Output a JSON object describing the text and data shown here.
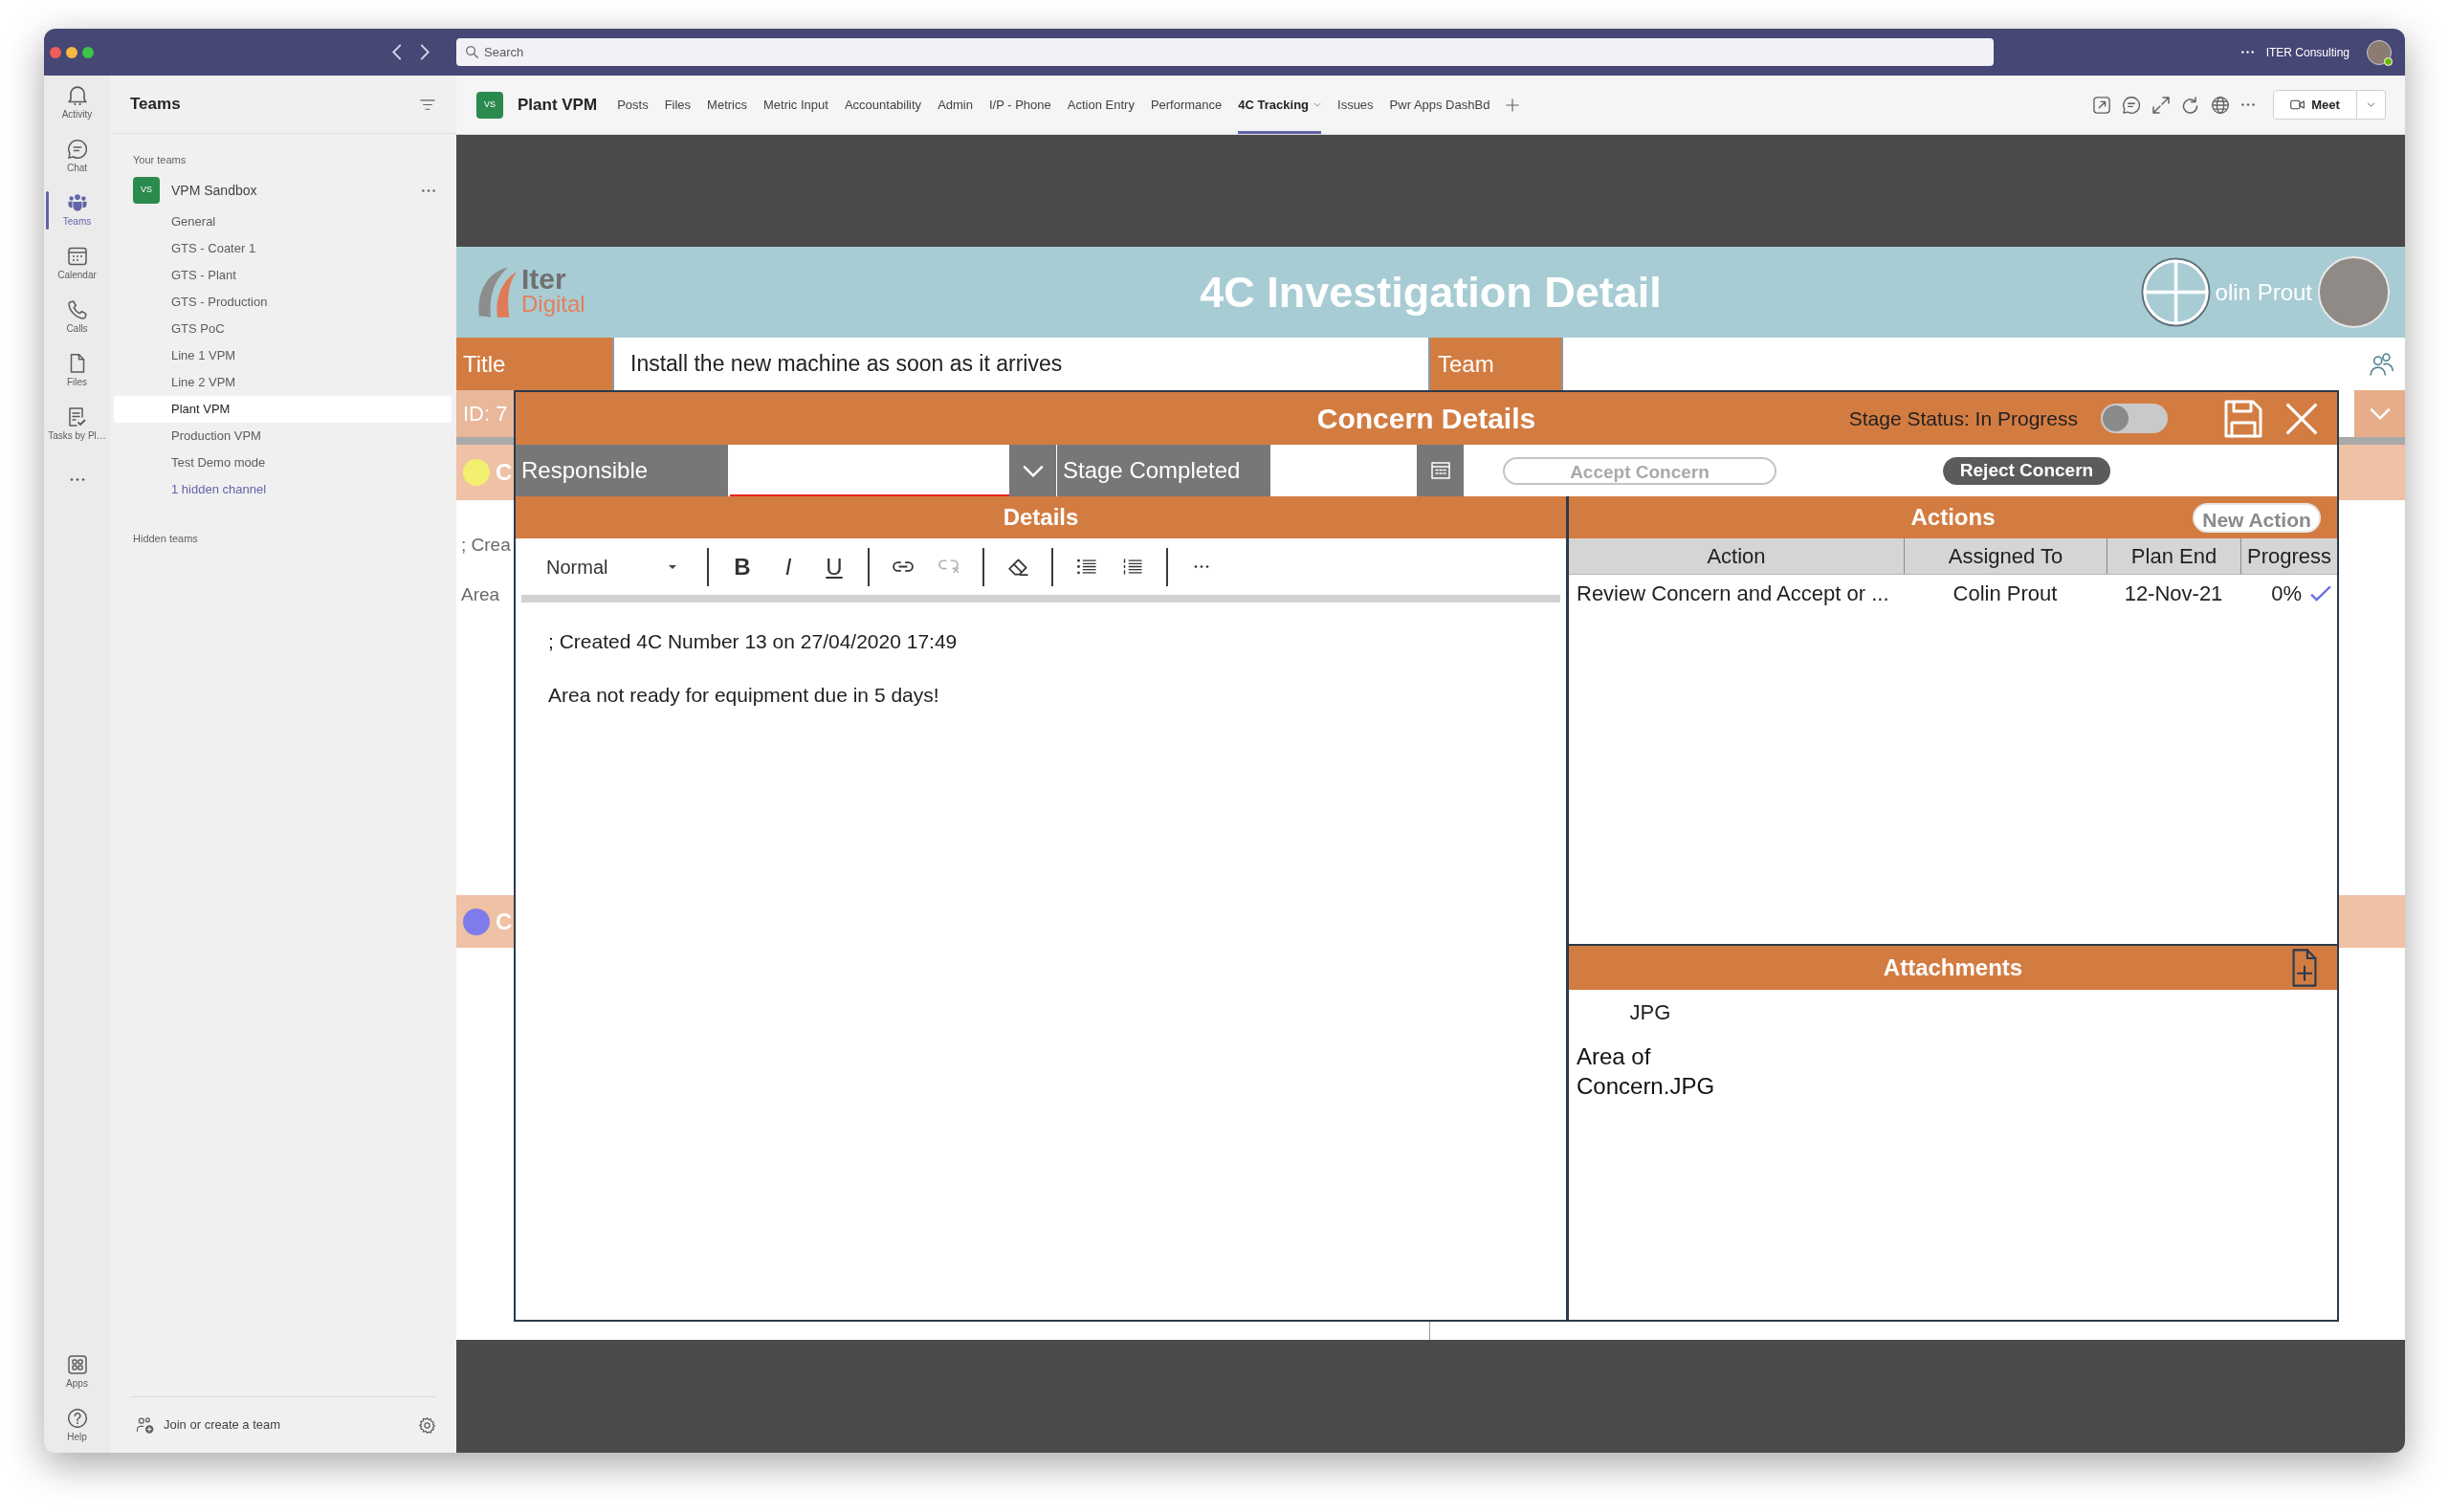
{
  "title_bar": {
    "search_placeholder": "Search",
    "account": "ITER Consulting"
  },
  "rail": {
    "items": [
      {
        "label": "Activity",
        "selected": false
      },
      {
        "label": "Chat",
        "selected": false
      },
      {
        "label": "Teams",
        "selected": true
      },
      {
        "label": "Calendar",
        "selected": false
      },
      {
        "label": "Calls",
        "selected": false
      },
      {
        "label": "Files",
        "selected": false
      },
      {
        "label": "Tasks by Pl…",
        "selected": false
      }
    ],
    "bottom_items": [
      {
        "label": "Apps"
      },
      {
        "label": "Help"
      }
    ]
  },
  "sidebar": {
    "title": "Teams",
    "section": "Your teams",
    "team": {
      "initials": "VS",
      "name": "VPM Sandbox",
      "channels": [
        {
          "name": "General",
          "selected": false
        },
        {
          "name": "GTS - Coater 1",
          "selected": false
        },
        {
          "name": "GTS - Plant",
          "selected": false
        },
        {
          "name": "GTS - Production",
          "selected": false
        },
        {
          "name": "GTS PoC",
          "selected": false
        },
        {
          "name": "Line 1 VPM",
          "selected": false
        },
        {
          "name": "Line 2 VPM",
          "selected": false
        },
        {
          "name": "Plant VPM",
          "selected": true
        },
        {
          "name": "Production VPM",
          "selected": false
        },
        {
          "name": "Test Demo mode",
          "selected": false
        }
      ],
      "hidden_channels": "1 hidden channel"
    },
    "hidden_teams": "Hidden teams",
    "join": "Join or create a team"
  },
  "channel_bar": {
    "initials": "VS",
    "name": "Plant VPM",
    "tabs": [
      {
        "label": "Posts",
        "selected": false,
        "dropdown": false
      },
      {
        "label": "Files",
        "selected": false,
        "dropdown": false
      },
      {
        "label": "Metrics",
        "selected": false,
        "dropdown": false
      },
      {
        "label": "Metric Input",
        "selected": false,
        "dropdown": false
      },
      {
        "label": "Accountability",
        "selected": false,
        "dropdown": false
      },
      {
        "label": "Admin",
        "selected": false,
        "dropdown": false
      },
      {
        "label": "I/P - Phone",
        "selected": false,
        "dropdown": false
      },
      {
        "label": "Action Entry",
        "selected": false,
        "dropdown": false
      },
      {
        "label": "Performance",
        "selected": false,
        "dropdown": false
      },
      {
        "label": "4C Tracking",
        "selected": true,
        "dropdown": true
      },
      {
        "label": "Issues",
        "selected": false,
        "dropdown": false
      },
      {
        "label": "Pwr Apps DashBd",
        "selected": false,
        "dropdown": false
      }
    ],
    "meet": "Meet"
  },
  "app": {
    "logo": {
      "line_1": "Iter",
      "line_2": "Digital"
    },
    "title": "4C Investigation Detail",
    "user": "olin Prout",
    "title_field": {
      "label": "Title",
      "value": "Install the new machine as soon as it arrives"
    },
    "team_field": {
      "label": "Team"
    },
    "behind": {
      "id": "ID: 7",
      "rows": [
        {
          "color": "#f3ef6f",
          "initial": "C"
        },
        {
          "color": "#7e7ceb",
          "initial": "C"
        }
      ],
      "notes": [
        "; Crea",
        "Area"
      ]
    },
    "concern": {
      "title": "Concern Details",
      "stage_status": "Stage Status: In Progress",
      "status_toggle": {
        "on": false
      },
      "responsible": {
        "label": "Responsible",
        "error": true
      },
      "stage_completed": {
        "label": "Stage Completed"
      },
      "accept_button": {
        "label": "Accept Concern",
        "disabled": true
      },
      "reject_button": {
        "label": "Reject Concern",
        "disabled": false
      },
      "details": {
        "title": "Details",
        "style": "Normal",
        "format_buttons": [
          {
            "label": "B",
            "kind": "bold"
          },
          {
            "label": "I",
            "kind": "italic"
          },
          {
            "label": "U",
            "kind": "underline"
          }
        ],
        "paragraphs": [
          "; Created 4C Number 13 on 27/04/2020 17:49",
          "Area not ready for equipment due in 5 days!"
        ]
      },
      "actions": {
        "title": "Actions",
        "new_button": "New Action",
        "columns": [
          "Action",
          "Assigned To",
          "Plan End",
          "Progress"
        ],
        "rows": [
          {
            "action": "Review Concern and Accept or ...",
            "assigned_to": "Colin Prout",
            "plan_end": "12-Nov-21",
            "progress": "0%"
          }
        ]
      },
      "attachments": {
        "title": "Attachments",
        "files": [
          {
            "type": "JPG",
            "name": "Area of Concern.JPG"
          }
        ]
      }
    }
  }
}
